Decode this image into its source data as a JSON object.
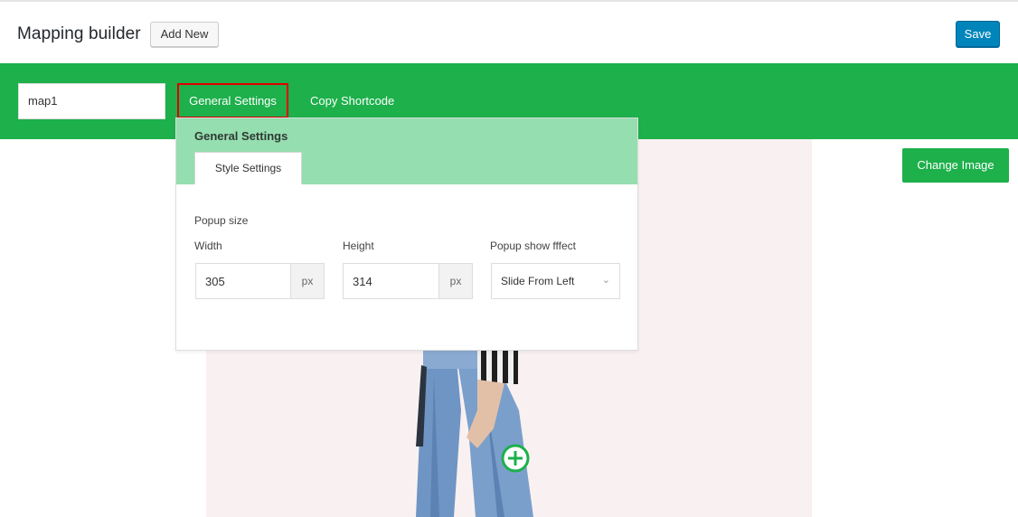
{
  "header": {
    "title": "Mapping builder",
    "add_new_label": "Add New",
    "save_label": "Save"
  },
  "toolbar": {
    "map_name": "map1",
    "tabs": [
      {
        "label": "General Settings"
      },
      {
        "label": "Copy Shortcode"
      }
    ]
  },
  "canvas": {
    "change_image_label": "Change Image"
  },
  "settings_panel": {
    "title": "General Settings",
    "tab_label": "Style Settings",
    "popup_size_label": "Popup size",
    "width": {
      "label": "Width",
      "value": "305",
      "unit": "px"
    },
    "height": {
      "label": "Height",
      "value": "314",
      "unit": "px"
    },
    "effect": {
      "label": "Popup show fffect",
      "value": "Slide From Left"
    }
  },
  "colors": {
    "accent_green": "#1db04b",
    "panel_header_green": "#95deaf",
    "save_blue": "#0085ba",
    "highlight_red": "#e00000",
    "canvas_bg": "#f9f1f1"
  },
  "icons": [
    "chevron-down-icon",
    "add-hotspot-icon"
  ]
}
